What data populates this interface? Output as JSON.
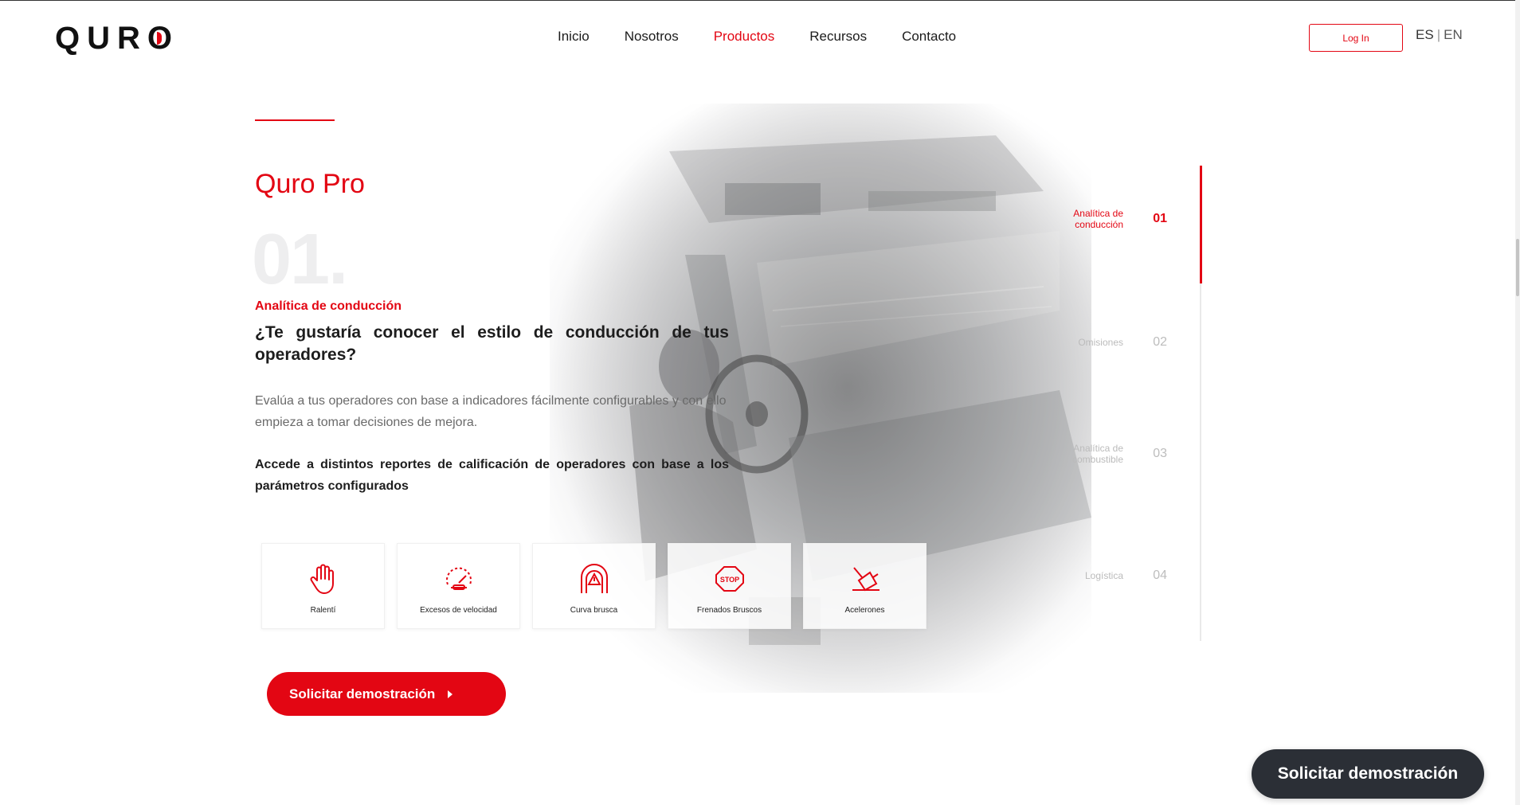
{
  "header": {
    "logo": "QURO",
    "nav": [
      {
        "label": "Inicio",
        "active": false
      },
      {
        "label": "Nosotros",
        "active": false
      },
      {
        "label": "Productos",
        "active": true
      },
      {
        "label": "Recursos",
        "active": false
      },
      {
        "label": "Contacto",
        "active": false
      }
    ],
    "login_label": "Log In",
    "lang_es": "ES",
    "lang_sep": "|",
    "lang_en": "EN"
  },
  "content": {
    "product_title": "Quro Pro",
    "big_number": "01.",
    "subtitle": "Analítica de conducción",
    "question": "¿Te gustaría conocer el estilo de conducción de tus operadores?",
    "description": "Evalúa a tus operadores con base a indicadores fácilmente configurables y con ello empieza a tomar decisiones de mejora.",
    "bold_description": "Accede a distintos reportes de calificación de operadores con base a los parámetros configurados",
    "cards": [
      {
        "label": "Ralentí",
        "icon": "hand-stop-icon"
      },
      {
        "label": "Excesos de velocidad",
        "icon": "speedometer-icon"
      },
      {
        "label": "Curva brusca",
        "icon": "curve-warning-icon"
      },
      {
        "label": "Frenados Bruscos",
        "icon": "stop-sign-icon"
      },
      {
        "label": "Acelerones",
        "icon": "pedal-icon"
      }
    ],
    "cta_label": "Solicitar demostración"
  },
  "steps": [
    {
      "name": "Analítica de conducción",
      "num": "01",
      "active": true
    },
    {
      "name": "Omisiones",
      "num": "02",
      "active": false
    },
    {
      "name": "Analítica de combustible",
      "num": "03",
      "active": false
    },
    {
      "name": "Logística",
      "num": "04",
      "active": false
    }
  ],
  "floating_cta": "Solicitar demostración",
  "colors": {
    "accent": "#e30613",
    "dark": "#2b2f36"
  }
}
